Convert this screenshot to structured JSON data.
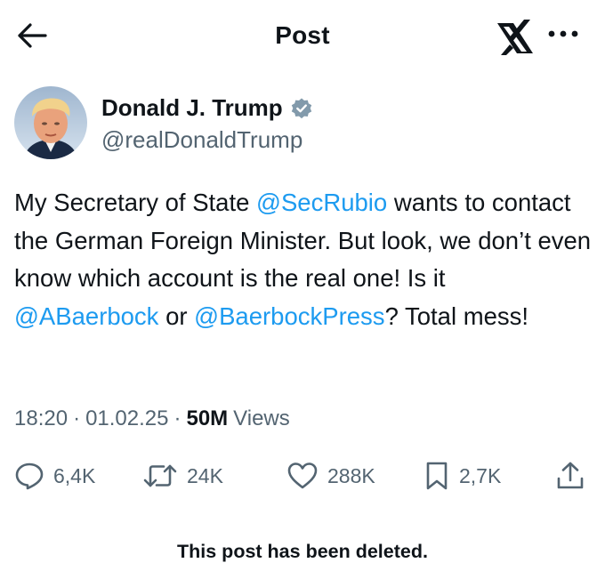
{
  "header": {
    "title": "Post",
    "icons": {
      "back": "arrow-left-icon",
      "logo": "x-logo",
      "more": "more-horizontal-icon"
    }
  },
  "author": {
    "display_name": "Donald J. Trump",
    "handle": "@realDonaldTrump",
    "verified_color": "#829aab"
  },
  "tweet": {
    "segments": [
      {
        "type": "text",
        "value": "My Secretary of State "
      },
      {
        "type": "mention",
        "value": "@SecRubio"
      },
      {
        "type": "text",
        "value": " wants to contact the German Foreign Minister. But look, we don’t even know which account is the real one! Is it "
      },
      {
        "type": "mention",
        "value": "@ABaerbock"
      },
      {
        "type": "text",
        "value": " or "
      },
      {
        "type": "mention",
        "value": "@BaerbockPress"
      },
      {
        "type": "text",
        "value": "? Total mess!"
      }
    ]
  },
  "meta": {
    "time": "18:20",
    "separator": "·",
    "date": "01.02.25",
    "views_count": "50M",
    "views_label": "Views"
  },
  "actions": {
    "replies": "6,4K",
    "reposts": "24K",
    "likes": "288K",
    "bookmarks": "2,7K",
    "icons": [
      "reply-icon",
      "repost-icon",
      "like-icon",
      "bookmark-icon",
      "share-icon"
    ]
  },
  "footer": {
    "deleted_notice": "This post has been deleted."
  },
  "colors": {
    "link": "#1d9bf0",
    "secondary_text": "#536471",
    "primary_text": "#0f1419"
  }
}
